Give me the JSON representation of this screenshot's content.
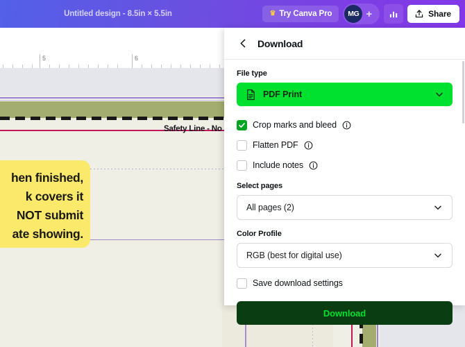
{
  "topbar": {
    "title": "Untitled design - 8.5in × 5.5in",
    "pro_button": "Try Canva Pro",
    "crown_icon": "crown-icon",
    "avatar_initials": "MG",
    "plus_label": "+",
    "stats_icon": "bar-chart-icon",
    "share_label": "Share",
    "share_icon": "upload-icon",
    "gradient_from": "#5360e8",
    "gradient_to": "#8338e8"
  },
  "panel": {
    "title": "Download",
    "back_icon": "chevron-left-icon",
    "file_type": {
      "label": "File type",
      "value": "PDF Print",
      "icon": "document-icon",
      "chevron": "chevron-down-icon",
      "color": "#00e02e"
    },
    "checkboxes": [
      {
        "label": "Crop marks and bleed",
        "checked": true,
        "info": "info-icon"
      },
      {
        "label": "Flatten PDF",
        "checked": false,
        "info": "info-icon"
      },
      {
        "label": "Include notes",
        "checked": false,
        "info": "info-icon"
      }
    ],
    "select_pages": {
      "label": "Select pages",
      "value": "All pages (2)",
      "chevron": "chevron-down-icon"
    },
    "color_profile": {
      "label": "Color Profile",
      "value": "RGB (best for digital use)",
      "chevron": "chevron-down-icon"
    },
    "save_settings": {
      "label": "Save download settings",
      "checked": false
    },
    "download_button": {
      "label": "Download",
      "bg": "#0b3d12",
      "fg": "#00e02e"
    }
  },
  "canvas": {
    "ruler": {
      "labels": [
        "5",
        "6"
      ],
      "label_positions": [
        60,
        195
      ]
    },
    "safety_line_label": "Safety Line - No",
    "sticky_note": {
      "lines": [
        "hen finished,",
        "k covers it",
        "NOT submit",
        "ate showing."
      ],
      "color": "#fbe96b"
    },
    "colors": {
      "page_cream": "#f0efe6",
      "bleed_olive": "#a3ad6f",
      "outside_gray": "#e5e5ec",
      "safety_crimson": "#c2185b",
      "guide_purple": "#9b7fd4"
    }
  }
}
